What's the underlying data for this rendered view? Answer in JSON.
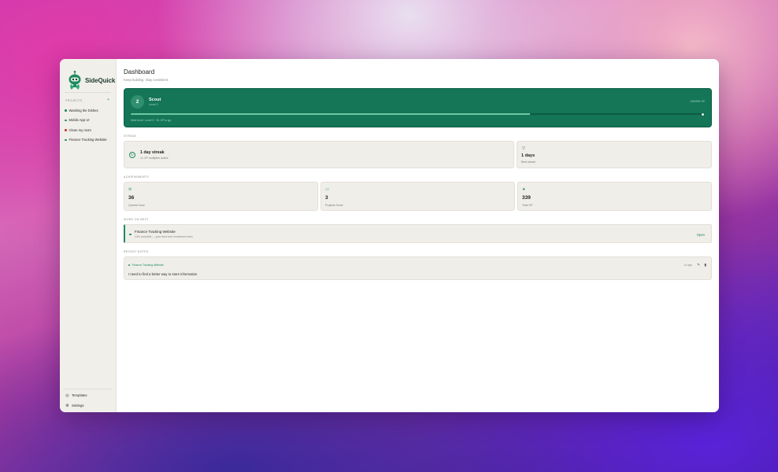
{
  "colors": {
    "accent": "#147557",
    "accent_light": "#6cc9a2",
    "card_bg": "#f0eee8",
    "sidebar_bg": "#f1efea"
  },
  "sidebar": {
    "brand": "SideQuick",
    "projects_label": "PROJECTS",
    "projects": [
      {
        "label": "Washing the Dishes",
        "color": "#1f8a62"
      },
      {
        "label": "Mobile App UI",
        "color": "#1f8a62"
      },
      {
        "label": "Clean my room",
        "color": "#c0392b"
      },
      {
        "label": "Finance Tracking Website",
        "color": "#1f8a62"
      }
    ],
    "bottom": [
      {
        "label": "Templates",
        "icon": "templates-icon"
      },
      {
        "label": "Settings",
        "icon": "gear-icon"
      }
    ]
  },
  "header": {
    "title": "Dashboard",
    "subtitle": "Keep building. Stay consistent."
  },
  "level": {
    "number": "2",
    "name": "Scout",
    "sub": "Level 2",
    "xp": "139/200 XP",
    "progress": 0.695,
    "next": "Next level: Level 3 · 61 XP to go"
  },
  "streak": {
    "section": "STREAK",
    "title": "1 day streak",
    "sub": "1× XP multiplier active",
    "best_value": "1 days",
    "best_label": "Best streak"
  },
  "achievements": {
    "section": "ACHIEVEMENTS",
    "items": [
      {
        "value": "36",
        "label": "Quests Done",
        "icon": "check-circle-icon"
      },
      {
        "value": "3",
        "label": "Projects Done",
        "icon": "folder-icon"
      },
      {
        "value": "339",
        "label": "Total XP",
        "icon": "star-icon"
      }
    ]
  },
  "work_next": {
    "section": "WORK ON NEXT",
    "title": "Finance Tracking Website",
    "sub": "44% complete — your best next momentum lives",
    "action": "Open"
  },
  "notes": {
    "section": "RECENT NOTES",
    "items": [
      {
        "tag": "Finance Tracking Website",
        "time": "1d ago",
        "text": "I need to find a better way to store information"
      }
    ]
  }
}
